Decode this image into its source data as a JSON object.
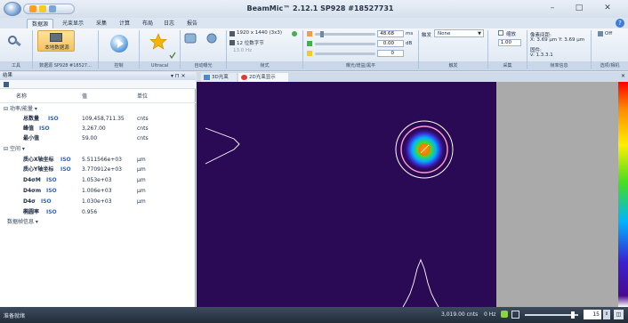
{
  "app": {
    "title": "BeamMic™ 2.12.1 SP928 #18527731"
  },
  "tabs": [
    "数据源",
    "光束显示",
    "采集",
    "计算",
    "布局",
    "日志",
    "报告"
  ],
  "ribbon": {
    "src_btn": "本地数据源",
    "resolution": "1920 x 1440 (3x3)",
    "bits": "12 位数字节",
    "freq": "13.0 Hz",
    "exposure_value": "48.68",
    "exposure_unit": "ms",
    "gain_value": "0.00",
    "gain_unit": "dB",
    "third_value": "0",
    "trigger_label": "触发",
    "trigger_value": "None",
    "scale_label": "缩放",
    "scale_value": "1.00",
    "pixel_size": "像素间距:",
    "pixel_xy": "X: 3.69 μm  Y: 3.69 μm",
    "firmware_label": "固件:",
    "firmware_value": "v: 1.3.3.1",
    "off_label": "Off",
    "group_labels": [
      "工具",
      "数据源 SP928 #18527...",
      "控制",
      "Ultracal",
      "自动曝光",
      "帧式",
      "曝光/增益/黑平",
      "触发",
      "采集",
      "帧率信息",
      "选项/相机"
    ]
  },
  "left_panel": {
    "title": "结果",
    "columns": [
      "名称",
      "值",
      "单位"
    ],
    "category_power": "功率/能量",
    "category_spatial": "空间",
    "category_more": "数据帧信息",
    "iso_tag": "ISO",
    "rows_power": [
      {
        "name": "总数量",
        "value": "109,458,711.35",
        "unit": "cnts"
      },
      {
        "name": "峰值",
        "value": "3,267.00",
        "unit": "cnts"
      },
      {
        "name": "最小值",
        "value": "59.00",
        "unit": "cnts"
      }
    ],
    "rows_spatial": [
      {
        "name": "质心X轴坐标",
        "value": "5.511566e+03",
        "unit": "μm"
      },
      {
        "name": "质心Y轴坐标",
        "value": "3.770912e+03",
        "unit": "μm"
      },
      {
        "name": "D4σM",
        "value": "1.053e+03",
        "unit": "μm"
      },
      {
        "name": "D4σm",
        "value": "1.006e+03",
        "unit": "μm"
      },
      {
        "name": "D4σ",
        "value": "1.030e+03",
        "unit": "μm"
      },
      {
        "name": "椭圆率",
        "value": "0.956",
        "unit": ""
      }
    ]
  },
  "display_tabs": [
    "3D光束",
    "2D光束显示"
  ],
  "status": {
    "left": "准备就绪",
    "counts": "3,019.00 cnts",
    "hz": "0 Hz",
    "zoom": "15"
  },
  "colors": {
    "canvas_bg": "#2a0a55",
    "status_bg": "#2a3544"
  }
}
